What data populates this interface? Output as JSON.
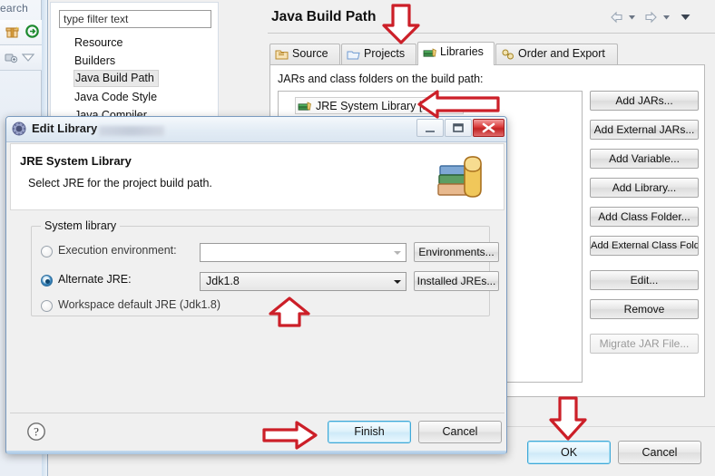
{
  "workbench": {
    "left_tab_label": "earch",
    "icons": [
      "gift-icon",
      "green-circle-icon",
      "debug-icon",
      "triangle-filter-icon"
    ]
  },
  "properties_dialog": {
    "title": "Java Build Path",
    "tree": {
      "filter_placeholder": "type filter text",
      "filter_value": "",
      "items": [
        {
          "label": "Resource",
          "selected": false
        },
        {
          "label": "Builders",
          "selected": false
        },
        {
          "label": "Java Build Path",
          "selected": true
        },
        {
          "label": "Java Code Style",
          "selected": false
        },
        {
          "label": "Java Compiler",
          "selected": false
        }
      ]
    },
    "nav": {
      "back_icon": "back-arrow-icon",
      "back_menu_icon": "chevron-down-icon",
      "forward_icon": "forward-arrow-icon",
      "forward_menu_icon": "chevron-down-icon",
      "view_menu_icon": "chevron-down-filled-icon"
    },
    "tabs": [
      {
        "label": "Source",
        "icon": "source-folder-icon",
        "active": false
      },
      {
        "label": "Projects",
        "icon": "projects-icon",
        "active": false
      },
      {
        "label": "Libraries",
        "icon": "libraries-icon",
        "active": true
      },
      {
        "label": "Order and Export",
        "icon": "order-export-icon",
        "active": false
      }
    ],
    "libraries_tab": {
      "description": "JARs and class folders on the build path:",
      "entries": [
        {
          "label": "JRE System Library [Jdk1.8]",
          "icon": "jre-library-icon",
          "selected": true
        }
      ],
      "buttons": [
        {
          "label": "Add JARs...",
          "enabled": true
        },
        {
          "label": "Add External JARs...",
          "enabled": true
        },
        {
          "label": "Add Variable...",
          "enabled": true
        },
        {
          "label": "Add Library...",
          "enabled": true
        },
        {
          "label": "Add Class Folder...",
          "enabled": true
        },
        {
          "label": "Add External Class Folder...",
          "enabled": true
        },
        {
          "label": "Edit...",
          "enabled": true
        },
        {
          "label": "Remove",
          "enabled": true
        },
        {
          "label": "Migrate JAR File...",
          "enabled": false
        }
      ]
    },
    "footer": {
      "ok_label": "OK",
      "cancel_label": "Cancel"
    }
  },
  "edit_library_dialog": {
    "titlebar": {
      "title": "Edit Library",
      "app_icon": "eclipse-dialog-icon",
      "minimize_icon": "minimize-icon",
      "maximize_icon": "maximize-icon",
      "close_icon": "close-icon"
    },
    "header": {
      "heading": "JRE System Library",
      "subheading": "Select JRE for the project build path.",
      "image": "books-stack-icon"
    },
    "group": {
      "title": "System library",
      "options": [
        {
          "id": "execution-environment",
          "label": "Execution environment:",
          "selected": false,
          "combo_value": "",
          "combo_enabled": false,
          "side_button": "Environments..."
        },
        {
          "id": "alternate-jre",
          "label": "Alternate JRE:",
          "selected": true,
          "combo_value": "Jdk1.8",
          "combo_enabled": true,
          "side_button": "Installed JREs..."
        },
        {
          "id": "workspace-default-jre",
          "label": "Workspace default JRE (Jdk1.8)",
          "selected": false
        }
      ]
    },
    "footer": {
      "help_icon": "help-question-icon",
      "finish_label": "Finish",
      "cancel_label": "Cancel"
    }
  },
  "annotations": [
    {
      "id": "arrow-libraries-tab",
      "direction": "down",
      "color": "#cc1f28"
    },
    {
      "id": "arrow-jre-entry",
      "direction": "left",
      "color": "#cc1f28"
    },
    {
      "id": "arrow-alternate-jre",
      "direction": "up",
      "color": "#cc1f28"
    },
    {
      "id": "arrow-finish-button",
      "direction": "right",
      "color": "#cc1f28"
    },
    {
      "id": "arrow-ok-button",
      "direction": "down",
      "color": "#cc1f28"
    }
  ]
}
